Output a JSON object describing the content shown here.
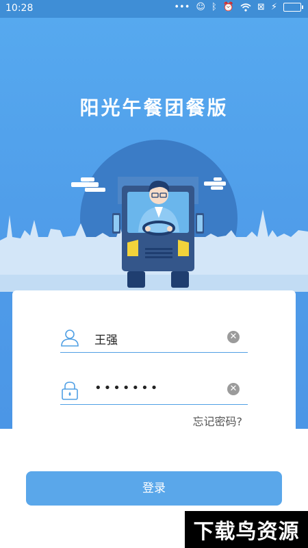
{
  "status_bar": {
    "time": "10:28",
    "dots": "•••",
    "icons": [
      "face-icon",
      "bluetooth-icon",
      "alarm-off-icon",
      "wifi-icon",
      "sim-off-icon",
      "charging-icon",
      "battery-icon"
    ]
  },
  "app": {
    "title": "阳光午餐团餐版"
  },
  "login": {
    "username_value": "王强",
    "password_value": "•••••••",
    "forgot_label": "忘记密码?",
    "submit_label": "登录"
  },
  "watermark": {
    "text": "下载鸟资源"
  },
  "colors": {
    "status_bar": "#3f8ed6",
    "hero_bg": "#4f9ce9",
    "accent": "#4f9fe4",
    "button": "#5aa7ea"
  }
}
